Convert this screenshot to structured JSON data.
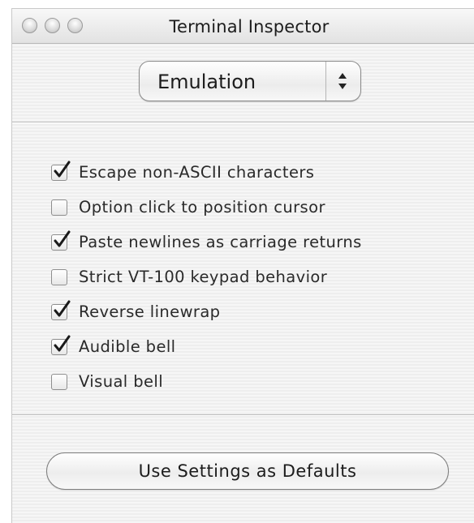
{
  "window": {
    "title": "Terminal Inspector"
  },
  "panel_popup": {
    "selected": "Emulation"
  },
  "options": [
    {
      "label": "Escape non-ASCII characters",
      "checked": true
    },
    {
      "label": "Option click to position cursor",
      "checked": false
    },
    {
      "label": "Paste newlines as carriage returns",
      "checked": true
    },
    {
      "label": "Strict VT-100 keypad behavior",
      "checked": false
    },
    {
      "label": "Reverse linewrap",
      "checked": true
    },
    {
      "label": "Audible bell",
      "checked": true
    },
    {
      "label": "Visual bell",
      "checked": false
    }
  ],
  "actions": {
    "defaults_label": "Use Settings as Defaults"
  },
  "icons": {
    "close": "close-icon",
    "minimize": "minimize-icon",
    "zoom": "zoom-icon",
    "popup_arrows": "up-down-arrows-icon",
    "checkmark": "checkmark-icon"
  }
}
